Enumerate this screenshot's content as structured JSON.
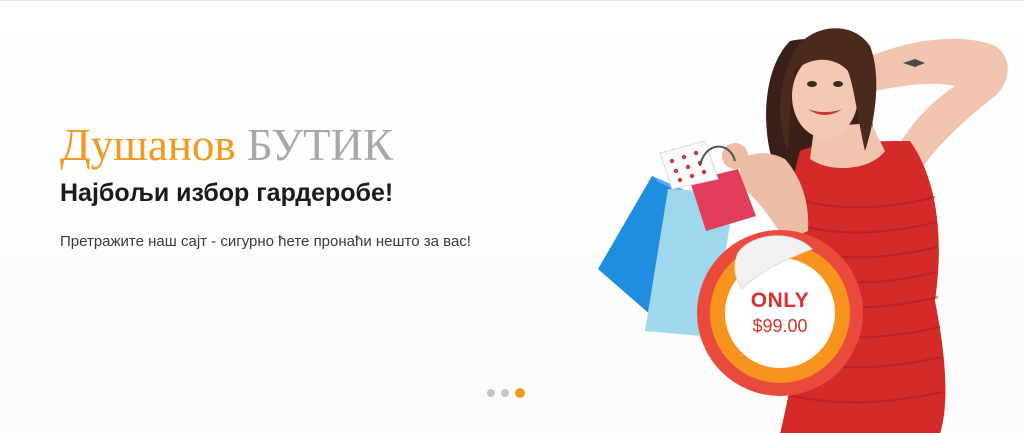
{
  "banner": {
    "brand_first": "Душанов",
    "brand_second": "БУТИК",
    "tagline": "Најбољи избор гардеробе!",
    "description": "Претражите наш сајт - сигурно ћете пронаћи нешто за вас!"
  },
  "badge": {
    "label": "ONLY",
    "price": "$99.00"
  },
  "colors": {
    "accent_orange": "#f29a1f",
    "brand_gray": "#a8a8a8",
    "badge_red": "#d8322d"
  },
  "hero_image": {
    "icon": "woman-with-shopping-bags-illustration"
  },
  "slider": {
    "slide_count": 3,
    "active_index": 2
  }
}
